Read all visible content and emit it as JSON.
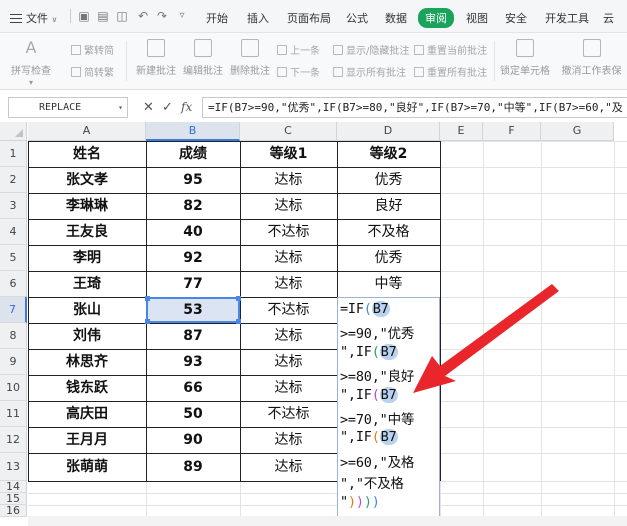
{
  "menubar": {
    "file_label": "文件",
    "tabs": [
      "开始",
      "插入",
      "页面布局",
      "公式",
      "数据",
      "审阅",
      "视图",
      "安全",
      "开发工具",
      "云"
    ],
    "active_tab": "审阅"
  },
  "ribbon": {
    "spellcheck": "拼写检查",
    "trad_to_simp": "繁转简",
    "simp_to_trad": "简转繁",
    "new_comment": "新建批注",
    "edit_comment": "编辑批注",
    "delete_comment": "删除批注",
    "prev": "上一条",
    "next": "下一条",
    "show_hide_comment": "显示/隐藏批注",
    "show_all_comments": "显示所有批注",
    "reset_current_comment": "重置当前批注",
    "reset_all_comments": "重置所有批注",
    "lock_cell": "锁定单元格",
    "unprotect_sheet": "撤消工作表保"
  },
  "formula_bar": {
    "name_box": "REPLACE",
    "fx_label": "fx",
    "formula": "=IF(B7>=90,\"优秀\",IF(B7>=80,\"良好\",IF(B7>=70,\"中等\",IF(B7>=60,\"及"
  },
  "columns": [
    "A",
    "B",
    "C",
    "D",
    "E",
    "F",
    "G"
  ],
  "rows": [
    "1",
    "2",
    "3",
    "4",
    "5",
    "6",
    "7",
    "8",
    "9",
    "10",
    "11",
    "12",
    "13",
    "14",
    "15",
    "16"
  ],
  "table": {
    "headers": [
      "姓名",
      "成绩",
      "等级1",
      "等级2"
    ],
    "data": [
      [
        "张文孝",
        "95",
        "达标",
        "优秀"
      ],
      [
        "李琳琳",
        "82",
        "达标",
        "良好"
      ],
      [
        "王友良",
        "40",
        "不达标",
        "不及格"
      ],
      [
        "李明",
        "92",
        "达标",
        "优秀"
      ],
      [
        "王琦",
        "77",
        "达标",
        "中等"
      ],
      [
        "张山",
        "53",
        "不达标",
        ""
      ],
      [
        "刘伟",
        "87",
        "达标",
        ""
      ],
      [
        "林思齐",
        "93",
        "达标",
        ""
      ],
      [
        "钱东跃",
        "66",
        "达标",
        ""
      ],
      [
        "高庆田",
        "50",
        "不达标",
        ""
      ],
      [
        "王月月",
        "90",
        "达标",
        ""
      ],
      [
        "张萌萌",
        "89",
        "达标",
        ""
      ]
    ]
  },
  "editing_cell": {
    "lines": [
      [
        "=IF(",
        "B7",
        ""
      ],
      [
        ">=90,\"优秀",
        "",
        ""
      ],
      [
        "\",IF(",
        "B7",
        ""
      ],
      [
        ">=80,\"良好",
        "",
        ""
      ],
      [
        "\",IF(",
        "B7",
        ""
      ],
      [
        ">=70,\"中等",
        "",
        ""
      ],
      [
        "\",IF(",
        "B7",
        ""
      ],
      [
        ">=60,\"及格",
        "",
        ""
      ],
      [
        "\",\"不及格",
        "",
        ""
      ],
      [
        "\"",
        "))))",
        ""
      ]
    ]
  },
  "colors": {
    "active_tab": "#1aa35a",
    "selection": "#4a86e8",
    "arrow": "#e8262b"
  }
}
